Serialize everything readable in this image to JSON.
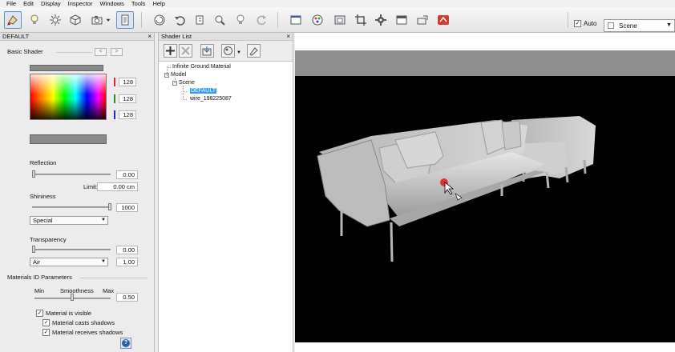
{
  "menu": [
    "File",
    "Edit",
    "Display",
    "Inspector",
    "Windows",
    "Tools",
    "Help"
  ],
  "toolbar": {
    "icons": [
      "material-tool-icon",
      "light-bulb-icon",
      "sun-icon",
      "cube-icon",
      "camera-icon",
      "dropdown-arrow-icon",
      "document-icon",
      "animation-icon",
      "undo-icon",
      "pan-icon",
      "zoom-icon",
      "refresh-icon",
      "viewport-icon",
      "color-palette-icon",
      "render-region-icon",
      "crop-icon",
      "settings-gear-icon",
      "window-icon",
      "export-icon",
      "render-icon"
    ],
    "auto_label": "Auto",
    "auto_checked": true,
    "scene_select": "Scene"
  },
  "left_panel": {
    "title": "DEFAULT",
    "basic_shader_label": "Basic Shader",
    "nav_prev": "<",
    "nav_next": ">",
    "rgb": [
      "128",
      "128",
      "128"
    ],
    "rgb_colors": [
      "#d42b2b",
      "#2a8a2a",
      "#2a2ad4"
    ],
    "reflection_label": "Reflection",
    "reflection_value": "0.00",
    "limit_label": "Limit:",
    "limit_value": "0.00 cm",
    "shininess_label": "Shininess",
    "shininess_value": "1000",
    "shininess_select": "Special",
    "transparency_label": "Transparency",
    "transparency_value": "0.00",
    "transparency_select": "Air",
    "ior_value": "1.00",
    "materials_id_label": "Materials ID Parameters",
    "min_label": "Min",
    "smoothness_label": "Smoothness",
    "max_label": "Max",
    "smoothness_value": "0.50",
    "checkboxes": [
      {
        "label": "Material is visible",
        "checked": true
      },
      {
        "label": "Material casts shadows",
        "checked": true
      },
      {
        "label": "Material receives shadows",
        "checked": true
      }
    ],
    "help_label": "?"
  },
  "shader_list": {
    "title": "Shader List",
    "tree": {
      "ground": "Infinite Ground Material",
      "model": "Model",
      "scene": "Scene",
      "default": "DEFAULT",
      "wire": "wire_198225087"
    }
  },
  "viewport": {
    "background": "#000000"
  }
}
